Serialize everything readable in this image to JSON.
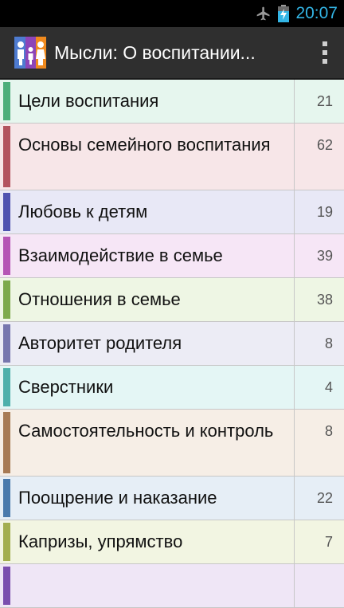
{
  "status": {
    "time": "20:07",
    "icons": [
      "airplane-icon",
      "battery-charging-icon"
    ]
  },
  "actionbar": {
    "title": "Мысли: О воспитании...",
    "icon": "family-app-icon",
    "menu_icon": "overflow-menu-icon"
  },
  "categories": [
    {
      "label": "Цели воспитания",
      "count": "21",
      "bar": "#4cae7a",
      "bg": "#e6f6ee",
      "lines": 1
    },
    {
      "label": "Основы семейного воспитания",
      "count": "62",
      "bar": "#b3535e",
      "bg": "#f7e6e8",
      "lines": 2
    },
    {
      "label": "Любовь к детям",
      "count": "19",
      "bar": "#4e52b0",
      "bg": "#e8e8f6",
      "lines": 1
    },
    {
      "label": "Взаимодействие в семье",
      "count": "39",
      "bar": "#b554b5",
      "bg": "#f6e6f6",
      "lines": 1
    },
    {
      "label": "Отношения в семье",
      "count": "38",
      "bar": "#7daa4b",
      "bg": "#eef6e4",
      "lines": 1
    },
    {
      "label": "Авторитет родителя",
      "count": "8",
      "bar": "#7777ae",
      "bg": "#ececf5",
      "lines": 1
    },
    {
      "label": "Сверстники",
      "count": "4",
      "bar": "#4db0ab",
      "bg": "#e4f6f5",
      "lines": 1
    },
    {
      "label": "Самостоятельность и контроль",
      "count": "8",
      "bar": "#a77a54",
      "bg": "#f6eee6",
      "lines": 2
    },
    {
      "label": "Поощрение и наказание",
      "count": "22",
      "bar": "#4a7aac",
      "bg": "#e6eef6",
      "lines": 1
    },
    {
      "label": "Капризы, упрямство",
      "count": "7",
      "bar": "#a2ae4e",
      "bg": "#f2f5e2",
      "lines": 1
    },
    {
      "label": "",
      "count": "",
      "bar": "#7a4eae",
      "bg": "#efe6f6",
      "lines": 1
    }
  ]
}
